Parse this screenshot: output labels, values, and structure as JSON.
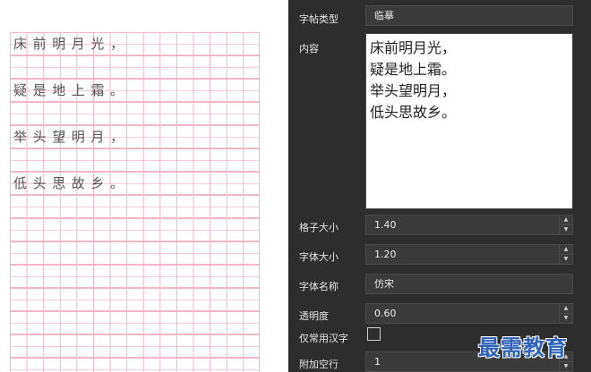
{
  "preview": {
    "lines": [
      "床前明月光，",
      "疑是地上霜。",
      "举头望明月，",
      "低头思故乡。"
    ]
  },
  "panel": {
    "copybook_type": {
      "label": "字帖类型",
      "value": "临摹"
    },
    "content": {
      "label": "内容",
      "lines": [
        "床前明月光，",
        "疑是地上霜。",
        "举头望明月，",
        "低头思故乡。"
      ]
    },
    "grid_size": {
      "label": "格子大小",
      "value": "1.40"
    },
    "font_size": {
      "label": "字体大小",
      "value": "1.20"
    },
    "font_name": {
      "label": "字体名称",
      "value": "仿宋"
    },
    "opacity": {
      "label": "透明度",
      "value": "0.60"
    },
    "common_only": {
      "label": "仅常用汉字",
      "checked": false
    },
    "extra_blank_rows": {
      "label": "附加空行",
      "value": "1"
    }
  },
  "watermark": {
    "text": "最需教育"
  },
  "colors": {
    "panel_bg": "#2d2d2d",
    "field_bg": "#3b3b3b",
    "grid_pink": "#f2b6c6",
    "watermark_blue": "#2f63b8"
  }
}
